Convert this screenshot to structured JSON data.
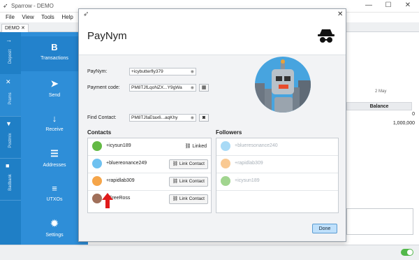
{
  "window": {
    "title": "Sparrow - DEMO",
    "controls": [
      "—",
      "☐",
      "✕"
    ]
  },
  "menu": [
    "File",
    "View",
    "Tools",
    "Help"
  ],
  "tab": {
    "label": "DEMO ✕"
  },
  "rail": [
    "Deposit",
    "Prams",
    "Postmix",
    "Badbank"
  ],
  "nav": [
    {
      "label": "Transactions",
      "icon": "bitcoin-icon",
      "glyph": "B"
    },
    {
      "label": "Send",
      "icon": "send-icon",
      "glyph": "➤"
    },
    {
      "label": "Receive",
      "icon": "receive-icon",
      "glyph": "↓"
    },
    {
      "label": "Addresses",
      "icon": "addresses-icon",
      "glyph": "☰"
    },
    {
      "label": "UTXOs",
      "icon": "utxos-icon",
      "glyph": "≡"
    },
    {
      "label": "Settings",
      "icon": "settings-icon",
      "glyph": "✹"
    }
  ],
  "background": {
    "chart_label": "2 May",
    "balance_header": "Balance",
    "balances": [
      "0",
      "1,000,000"
    ]
  },
  "dialog": {
    "title": "PayNym",
    "close": "✕",
    "paynym_label": "PayNym:",
    "paynym_value": "+icybutterfly379",
    "payment_code_label": "Payment code:",
    "payment_code_value": "PM8TJfLqoNZX...Y9gWa",
    "find_contact_label": "Find Contact:",
    "find_contact_value": "PM8TJfaEtax6...aqKhy",
    "contacts_title": "Contacts",
    "followers_title": "Followers",
    "contacts": [
      {
        "name": "+icysun189",
        "action": "Linked",
        "color": "#63b944"
      },
      {
        "name": "+bluereonance249",
        "action": "Link Contact",
        "color": "#6ec1f0"
      },
      {
        "name": "+rapidlab309",
        "action": "Link Contact",
        "color": "#f5a54a"
      },
      {
        "name": "+FreeRoss",
        "action": "Link Contact",
        "color": "#a0705a"
      }
    ],
    "followers": [
      {
        "name": "+blueresonance240",
        "color": "#6ec1f0"
      },
      {
        "name": "+rapidlab309",
        "color": "#f5a54a"
      },
      {
        "name": "+icysun189",
        "color": "#63b944"
      }
    ],
    "done_label": "Done"
  },
  "colors": {
    "rail": "#1f7fc6",
    "nav": "#2e8ed8",
    "accent_arrow": "#e01b1b"
  }
}
